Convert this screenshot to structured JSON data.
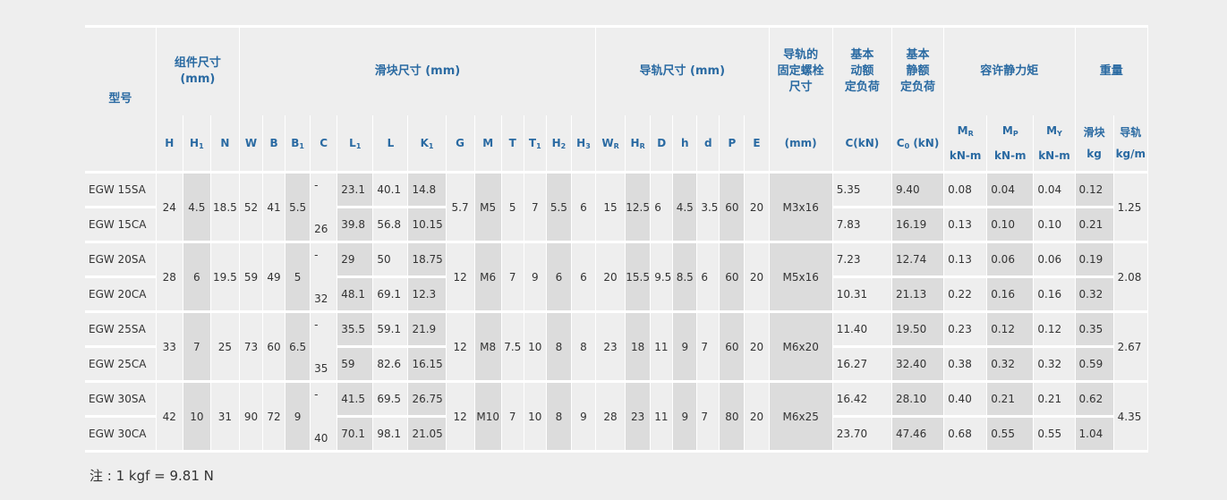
{
  "headers": {
    "model": "型号",
    "assembly": "组件尺寸\n(mm)",
    "block": "滑块尺寸 (mm)",
    "rail": "导轨尺寸 (mm)",
    "bolt": "导轨的\n固定螺栓\n尺寸",
    "dyn": "基本\n动额\n定负荷",
    "stat": "基本\n静额\n定负荷",
    "moment": "容许静力矩",
    "weight": "重量",
    "weight_block": "滑块",
    "weight_rail": "导轨",
    "cols": {
      "H": "H",
      "H1": "H",
      "H1_sub": "1",
      "N": "N",
      "W": "W",
      "B": "B",
      "B1": "B",
      "B1_sub": "1",
      "C": "C",
      "L1": "L",
      "L1_sub": "1",
      "L": "L",
      "K1": "K",
      "K1_sub": "1",
      "G": "G",
      "M": "M",
      "T": "T",
      "T1": "T",
      "T1_sub": "1",
      "H2": "H",
      "H2_sub": "2",
      "H3": "H",
      "H3_sub": "3",
      "WR": "W",
      "WR_sub": "R",
      "HR": "H",
      "HR_sub": "R",
      "D": "D",
      "h": "h",
      "d": "d",
      "P": "P",
      "E": "E",
      "mm": "(mm)",
      "CkN": "C(kN)",
      "C0": "C",
      "C0_sub": "0",
      "C0_unit": " (kN)",
      "MR": "M",
      "MR_sub": "R",
      "MP": "M",
      "MP_sub": "P",
      "MY": "M",
      "MY_sub": "Y",
      "knm1": "kN-m",
      "knm2": "kN-m",
      "knm3": "kN-m",
      "kg": "kg",
      "kgm": "kg/m"
    }
  },
  "groups": [
    {
      "H": "24",
      "H1": "4.5",
      "N": "18.5",
      "W": "52",
      "B": "41",
      "B1": "5.5",
      "G": "5.7",
      "M": "M5",
      "T": "5",
      "T1": "7",
      "H2": "5.5",
      "H3": "6",
      "WR": "15",
      "HR": "12.5",
      "D": "6",
      "h": "4.5",
      "d": "3.5",
      "P": "60",
      "E": "20",
      "bolt": "M3x16",
      "rail_kg": "1.25",
      "rows": [
        {
          "model": "EGW 15SA",
          "C": "-",
          "L1": "23.1",
          "L": "40.1",
          "K1": "14.8",
          "Cdyn": "5.35",
          "C0": "9.40",
          "MR": "0.08",
          "MP": "0.04",
          "MY": "0.04",
          "kg": "0.12"
        },
        {
          "model": "EGW 15CA",
          "C": "26",
          "L1": "39.8",
          "L": "56.8",
          "K1": "10.15",
          "Cdyn": "7.83",
          "C0": "16.19",
          "MR": "0.13",
          "MP": "0.10",
          "MY": "0.10",
          "kg": "0.21"
        }
      ]
    },
    {
      "H": "28",
      "H1": "6",
      "N": "19.5",
      "W": "59",
      "B": "49",
      "B1": "5",
      "G": "12",
      "M": "M6",
      "T": "7",
      "T1": "9",
      "H2": "6",
      "H3": "6",
      "WR": "20",
      "HR": "15.5",
      "D": "9.5",
      "h": "8.5",
      "d": "6",
      "P": "60",
      "E": "20",
      "bolt": "M5x16",
      "rail_kg": "2.08",
      "rows": [
        {
          "model": "EGW 20SA",
          "C": "-",
          "L1": "29",
          "L": "50",
          "K1": "18.75",
          "Cdyn": "7.23",
          "C0": "12.74",
          "MR": "0.13",
          "MP": "0.06",
          "MY": "0.06",
          "kg": "0.19"
        },
        {
          "model": "EGW 20CA",
          "C": "32",
          "L1": "48.1",
          "L": "69.1",
          "K1": "12.3",
          "Cdyn": "10.31",
          "C0": "21.13",
          "MR": "0.22",
          "MP": "0.16",
          "MY": "0.16",
          "kg": "0.32"
        }
      ]
    },
    {
      "H": "33",
      "H1": "7",
      "N": "25",
      "W": "73",
      "B": "60",
      "B1": "6.5",
      "G": "12",
      "M": "M8",
      "T": "7.5",
      "T1": "10",
      "H2": "8",
      "H3": "8",
      "WR": "23",
      "HR": "18",
      "D": "11",
      "h": "9",
      "d": "7",
      "P": "60",
      "E": "20",
      "bolt": "M6x20",
      "rail_kg": "2.67",
      "rows": [
        {
          "model": "EGW 25SA",
          "C": "-",
          "L1": "35.5",
          "L": "59.1",
          "K1": "21.9",
          "Cdyn": "11.40",
          "C0": "19.50",
          "MR": "0.23",
          "MP": "0.12",
          "MY": "0.12",
          "kg": "0.35"
        },
        {
          "model": "EGW 25CA",
          "C": "35",
          "L1": "59",
          "L": "82.6",
          "K1": "16.15",
          "Cdyn": "16.27",
          "C0": "32.40",
          "MR": "0.38",
          "MP": "0.32",
          "MY": "0.32",
          "kg": "0.59"
        }
      ]
    },
    {
      "H": "42",
      "H1": "10",
      "N": "31",
      "W": "90",
      "B": "72",
      "B1": "9",
      "G": "12",
      "M": "M10",
      "T": "7",
      "T1": "10",
      "H2": "8",
      "H3": "9",
      "WR": "28",
      "HR": "23",
      "D": "11",
      "h": "9",
      "d": "7",
      "P": "80",
      "E": "20",
      "bolt": "M6x25",
      "rail_kg": "4.35",
      "rows": [
        {
          "model": "EGW 30SA",
          "C": "-",
          "L1": "41.5",
          "L": "69.5",
          "K1": "26.75",
          "Cdyn": "16.42",
          "C0": "28.10",
          "MR": "0.40",
          "MP": "0.21",
          "MY": "0.21",
          "kg": "0.62"
        },
        {
          "model": "EGW 30CA",
          "C": "40",
          "L1": "70.1",
          "L": "98.1",
          "K1": "21.05",
          "Cdyn": "23.70",
          "C0": "47.46",
          "MR": "0.68",
          "MP": "0.55",
          "MY": "0.55",
          "kg": "1.04"
        }
      ]
    }
  ],
  "note": "注 : 1 kgf = 9.81 N",
  "colors": {
    "header_text": "#2a6aa2",
    "shade": "#dcdcdc",
    "background": "#eeeeee"
  }
}
